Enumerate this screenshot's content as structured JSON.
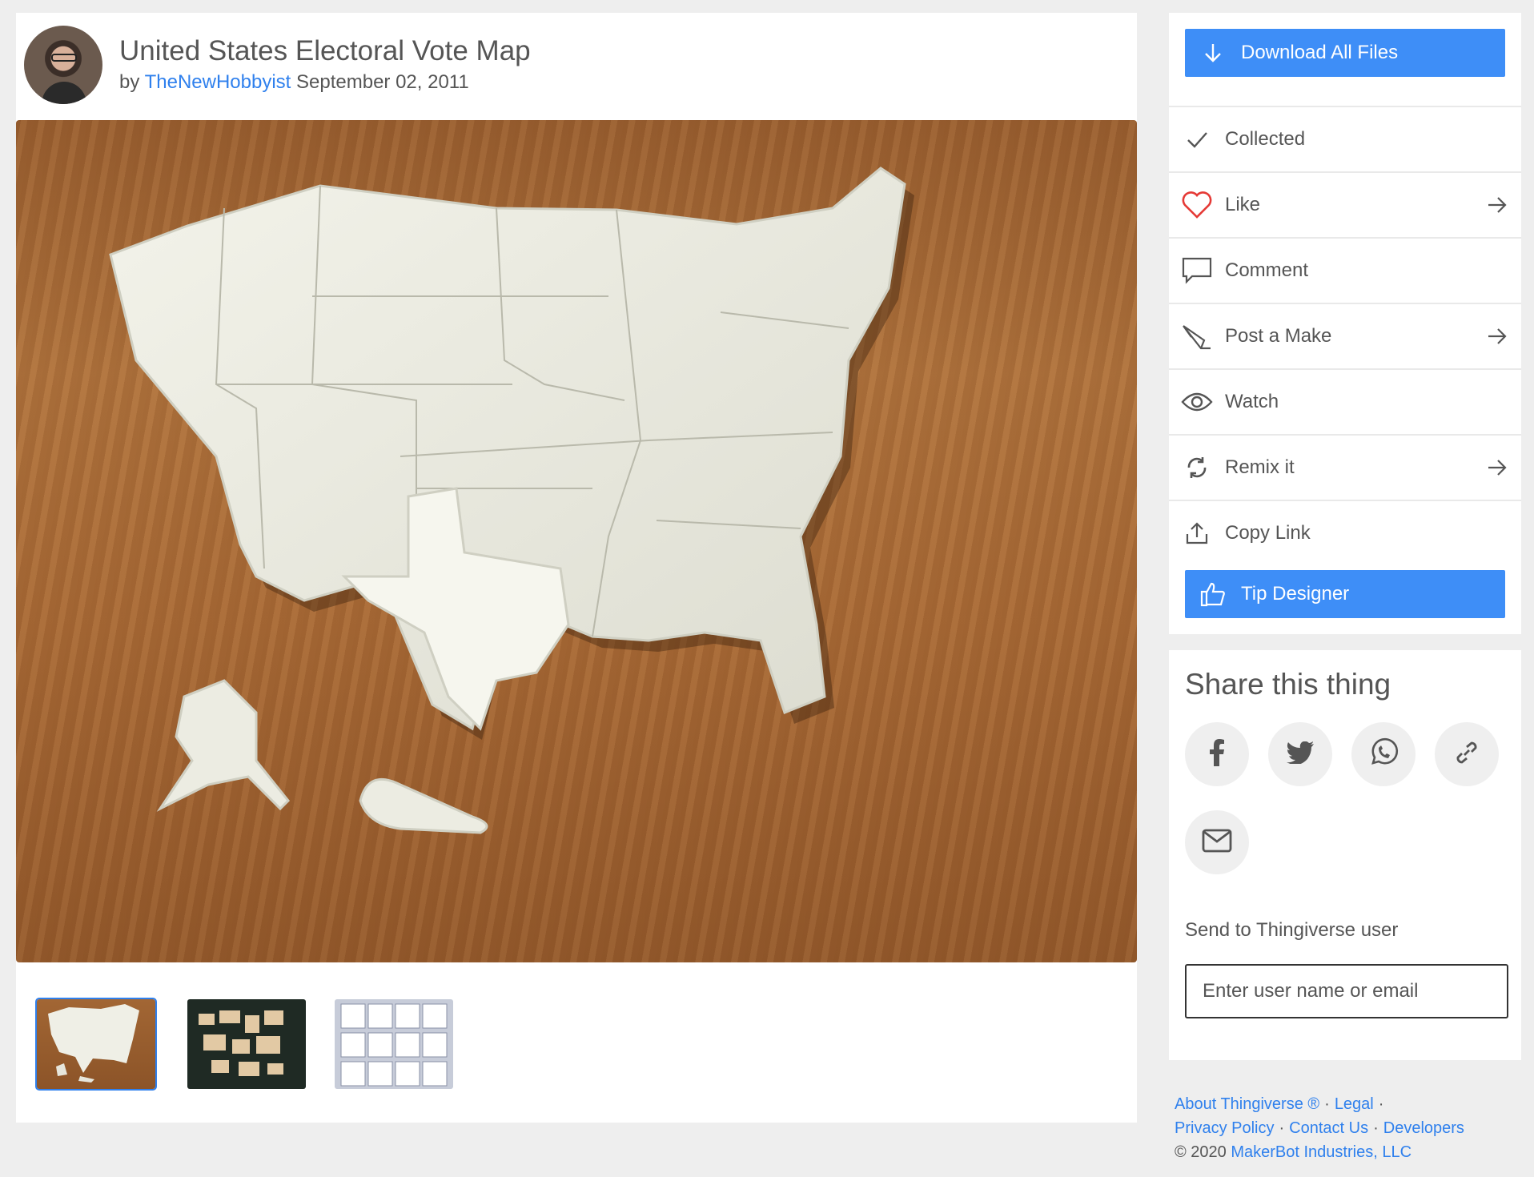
{
  "thing": {
    "title": "United States Electoral Vote Map",
    "by_prefix": "by",
    "author": "TheNewHobbyist",
    "date": "September 02, 2011"
  },
  "actions": {
    "download": "Download All Files",
    "collected": "Collected",
    "like": "Like",
    "comment": "Comment",
    "post_make": "Post a Make",
    "watch": "Watch",
    "remix": "Remix it",
    "copy_link": "Copy Link",
    "tip": "Tip Designer"
  },
  "share": {
    "heading": "Share this thing",
    "send_label": "Send to Thingiverse user",
    "input_placeholder": "Enter user name or email"
  },
  "footer": {
    "about": "About Thingiverse ®",
    "legal": "Legal",
    "privacy": "Privacy Policy",
    "contact": "Contact Us",
    "developers": "Developers",
    "copyright": "©  2020",
    "company": "MakerBot Industries, LLC",
    "separator": "·"
  },
  "colors": {
    "accent": "#3e8ef7",
    "link": "#2f80ed",
    "like_heart": "#e53935"
  },
  "icons": [
    "download-arrow-icon",
    "check-icon",
    "heart-icon",
    "comment-icon",
    "pen-icon",
    "eye-icon",
    "remix-icon",
    "upload-icon",
    "thumbs-up-icon",
    "facebook-icon",
    "twitter-icon",
    "whatsapp-icon",
    "link-icon",
    "mail-icon",
    "arrow-right-icon"
  ]
}
